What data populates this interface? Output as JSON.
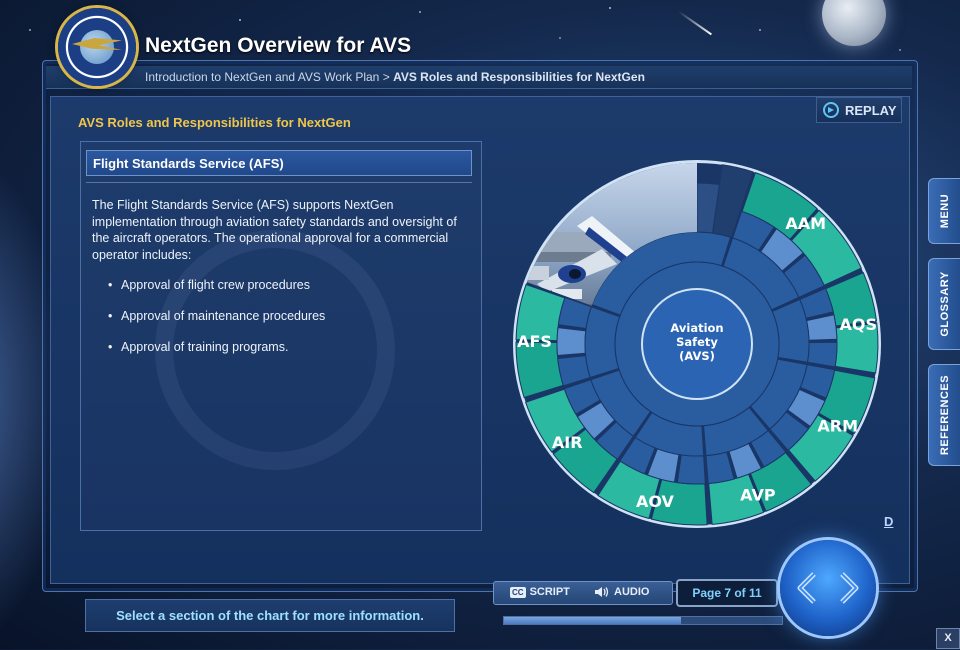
{
  "app": {
    "title": "NextGen Overview for AVS"
  },
  "logo": {
    "text_top": "FEDERAL AVIATION",
    "text_bottom": "ADMINISTRATION"
  },
  "breadcrumb": {
    "parent": "Introduction to NextGen and AVS Work Plan",
    "separator": ">",
    "current": "AVS Roles and Responsibilities for NextGen"
  },
  "section": {
    "title": "AVS Roles and Responsibilities for NextGen"
  },
  "replay": {
    "label": "REPLAY"
  },
  "panel": {
    "heading": "Flight Standards Service (AFS)",
    "body": "The Flight Standards Service (AFS) supports NextGen implementation through aviation safety standards and oversight of the aircraft operators. The operational approval for a commercial operator includes:",
    "bullets": [
      "Approval of flight crew procedures",
      "Approval of maintenance procedures",
      "Approval of training programs."
    ]
  },
  "wheel": {
    "center_label": [
      "Aviation",
      "Safety",
      "(AVS)"
    ],
    "segments": [
      "AAM",
      "AQS",
      "ARM",
      "AVP",
      "AOV",
      "AIR",
      "AFS"
    ],
    "colors": {
      "segment": "#19a58f",
      "segment_light": "#2cb9a1",
      "inner": "#2a5da0",
      "inner_light": "#5d8fcf",
      "core": "#2b64b3",
      "gap": "#1a3667"
    }
  },
  "side_tabs": [
    "MENU",
    "GLOSSARY",
    "REFERENCES"
  ],
  "d_link": "D",
  "instruction": "Select a section of the chart for more information.",
  "controls": {
    "script": "SCRIPT",
    "audio": "AUDIO",
    "cc": "CC"
  },
  "page": {
    "indicator": "Page 7 of 11",
    "current": 7,
    "total": 11
  },
  "close": "X"
}
